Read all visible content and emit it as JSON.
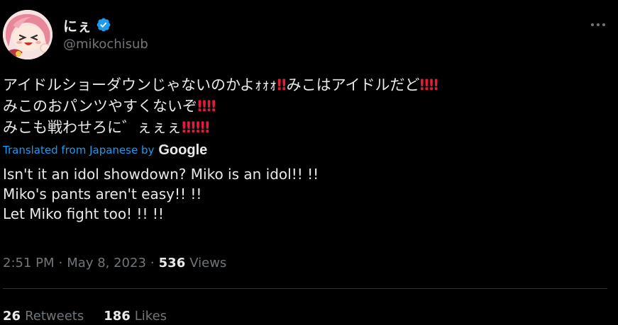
{
  "author": {
    "display_name": "にぇ",
    "handle": "@mikochisub",
    "verified": true,
    "verified_color": "#1d9bf0"
  },
  "more_icon": "more-horizontal-icon",
  "original": {
    "line1_text_a": "アイドルショーダウンじゃないのかよｫｫｫ",
    "line1_bang_a": "‼",
    "line1_text_b": "みこはアイドルだど",
    "line1_bang_b": "‼",
    "line1_bang_c": "‼",
    "line2_text_a": "みこのおパンツやすくないぞ",
    "line2_bang_a": "‼",
    "line2_bang_b": "‼",
    "line3_text_a": "みこも戦わせろに゛ぇぇぇ",
    "line3_bang_a": "‼",
    "line3_bang_b": "‼",
    "line3_bang_c": "‼",
    "bang_color": "#e01e3c"
  },
  "translation": {
    "label": "Translated from Japanese by",
    "provider": "Google",
    "lines": [
      "Isn't it an idol showdown?  Miko is an idol!! !!",
      "Miko's pants aren't easy!! !!",
      "Let Miko fight too! !! !!"
    ]
  },
  "meta": {
    "time": "2:51 PM",
    "separator": "·",
    "date": "May 8, 2023",
    "views_count": "536",
    "views_label": "Views"
  },
  "stats": {
    "retweets_count": "26",
    "retweets_label": "Retweets",
    "likes_count": "186",
    "likes_label": "Likes"
  },
  "colors": {
    "background": "#000000",
    "text_primary": "#e7e9ea",
    "text_secondary": "#71767b",
    "link": "#1d9bf0",
    "divider": "#2f3336"
  }
}
